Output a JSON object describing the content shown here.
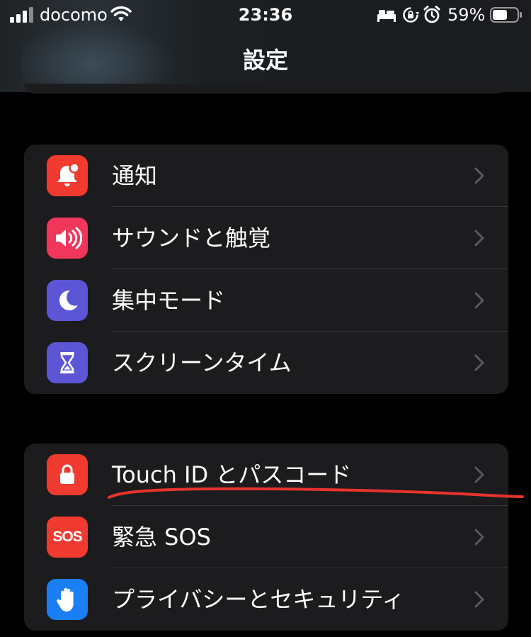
{
  "status_bar": {
    "carrier": "docomo",
    "time": "23:36",
    "battery": "59%"
  },
  "nav": {
    "title": "設定"
  },
  "groups": [
    {
      "items": [
        {
          "label": "通知",
          "icon": "bell-badge-icon",
          "color": "#f13a30"
        },
        {
          "label": "サウンドと触覚",
          "icon": "speaker-wave-icon",
          "color": "#f0365b"
        },
        {
          "label": "集中モード",
          "icon": "moon-icon",
          "color": "#5c55d6"
        },
        {
          "label": "スクリーンタイム",
          "icon": "hourglass-icon",
          "color": "#5c55d6"
        }
      ]
    },
    {
      "items": [
        {
          "label": "Touch ID とパスコード",
          "icon": "lock-icon",
          "color": "#f13a30"
        },
        {
          "label": "緊急 SOS",
          "icon": "sos-icon",
          "color": "#f13a30",
          "icon_text": "SOS"
        },
        {
          "label": "プライバシーとセキュリティ",
          "icon": "hand-icon",
          "color": "#1c7ef5"
        }
      ]
    }
  ],
  "annotation": {
    "color": "#e8332e"
  }
}
